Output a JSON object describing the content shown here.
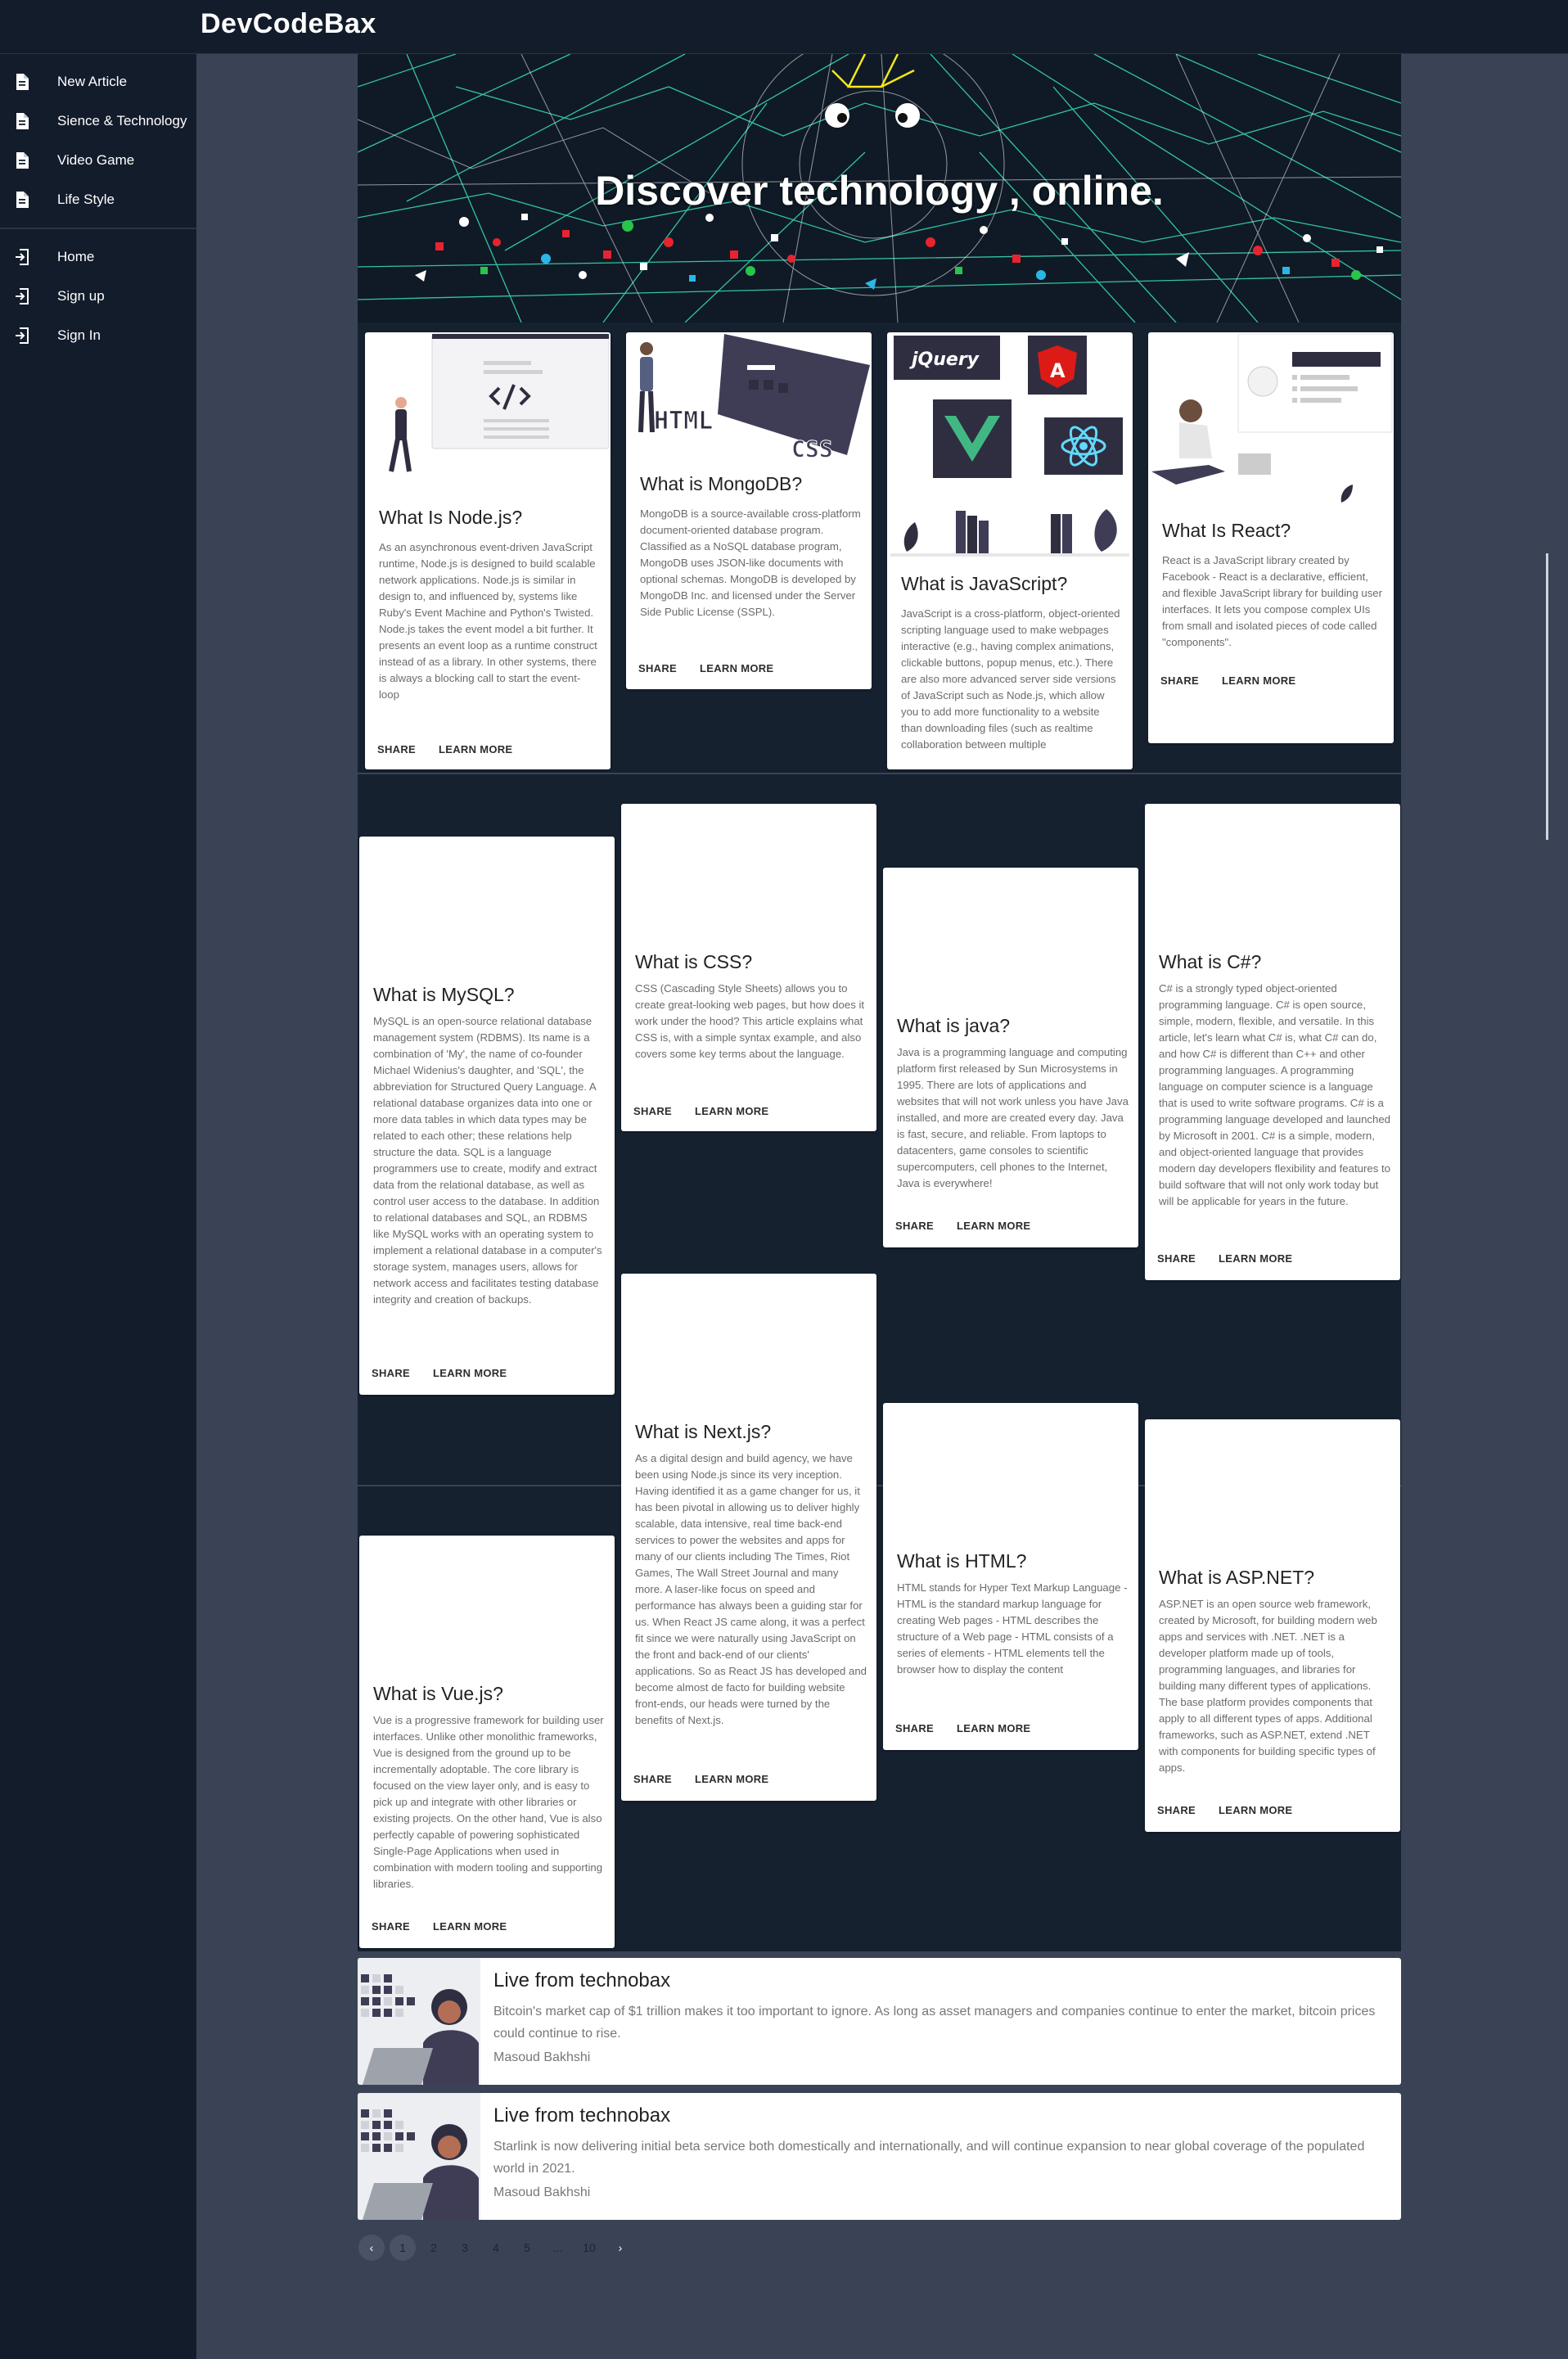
{
  "app": {
    "title": "DevCodeBax"
  },
  "sidebar": {
    "items": [
      {
        "label": "New Article",
        "icon": "article-icon"
      },
      {
        "label": "Sience & Technology",
        "icon": "article-icon"
      },
      {
        "label": "Video Game",
        "icon": "article-icon"
      },
      {
        "label": "Life Style",
        "icon": "article-icon"
      }
    ],
    "account_items": [
      {
        "label": "Home",
        "icon": "login-icon"
      },
      {
        "label": "Sign up",
        "icon": "login-icon"
      },
      {
        "label": "Sign In",
        "icon": "login-icon"
      }
    ]
  },
  "hero": {
    "title": "Discover technology , online."
  },
  "actions": {
    "share": "SHARE",
    "learn_more": "LEARN MORE"
  },
  "cards": [
    {
      "title": "What Is Node.js?",
      "image": "nodejs-illustration",
      "text": "As an asynchronous event-driven JavaScript runtime, Node.js is designed to build scalable network applications. Node.js is similar in design to, and influenced by, systems like Ruby's Event Machine and Python's Twisted. Node.js takes the event model a bit further. It presents an event loop as a runtime construct instead of as a library. In other systems, there is always a blocking call to start the event-loop"
    },
    {
      "title": "What is MongoDB?",
      "image": "html-css-illustration",
      "text": "MongoDB is a source-available cross-platform document-oriented database program. Classified as a NoSQL database program, MongoDB uses JSON-like documents with optional schemas. MongoDB is developed by MongoDB Inc. and licensed under the Server Side Public License (SSPL)."
    },
    {
      "title": "What is JavaScript?",
      "image": "js-frameworks-illustration",
      "text": "JavaScript is a cross-platform, object-oriented scripting language used to make webpages interactive (e.g., having complex animations, clickable buttons, popup menus, etc.). There are also more advanced server side versions of JavaScript such as Node.js, which allow you to add more functionality to a website than downloading files (such as realtime collaboration between multiple"
    },
    {
      "title": "What Is React?",
      "image": "react-illustration",
      "text": "React is a JavaScript library created by Facebook - React is a declarative, efficient, and flexible JavaScript library for building user interfaces. It lets you compose complex UIs from small and isolated pieces of code called \"components\"."
    },
    {
      "title": "What is MySQL?",
      "text": "MySQL is an open-source relational database management system (RDBMS). Its name is a combination of 'My', the name of co-founder Michael Widenius's daughter, and 'SQL', the abbreviation for Structured Query Language. A relational database organizes data into one or more data tables in which data types may be related to each other; these relations help structure the data. SQL is a language programmers use to create, modify and extract data from the relational database, as well as control user access to the database. In addition to relational databases and SQL, an RDBMS like MySQL works with an operating system to implement a relational database in a computer's storage system, manages users, allows for network access and facilitates testing database integrity and creation of backups."
    },
    {
      "title": "What is CSS?",
      "text": "CSS (Cascading Style Sheets) allows you to create great-looking web pages, but how does it work under the hood? This article explains what CSS is, with a simple syntax example, and also covers some key terms about the language."
    },
    {
      "title": "What is java?",
      "text": "Java is a programming language and computing platform first released by Sun Microsystems in 1995. There are lots of applications and websites that will not work unless you have Java installed, and more are created every day. Java is fast, secure, and reliable. From laptops to datacenters, game consoles to scientific supercomputers, cell phones to the Internet, Java is everywhere!"
    },
    {
      "title": "What is C#?",
      "text": "C# is a strongly typed object-oriented programming language. C# is open source, simple, modern, flexible, and versatile. In this article, let's learn what C# is, what C# can do, and how C# is different than C++ and other programming languages. A programming language on computer science is a language that is used to write software programs. C# is a programming language developed and launched by Microsoft in 2001. C# is a simple, modern, and object-oriented language that provides modern day developers flexibility and features to build software that will not only work today but will be applicable for years in the future."
    },
    {
      "title": "What is Next.js?",
      "text": "As a digital design and build agency, we have been using Node.js since its very inception. Having identified it as a game changer for us, it has been pivotal in allowing us to deliver highly scalable, data intensive, real time back-end services to power the websites and apps for many of our clients including The Times, Riot Games, The Wall Street Journal and many more. A laser-like focus on speed and performance has always been a guiding star for us. When React JS came along, it was a perfect fit since we were naturally using JavaScript on the front and back-end of our clients' applications. So as React JS has developed and become almost de facto for building website front-ends, our heads were turned by the benefits of Next.js."
    },
    {
      "title": "What is HTML?",
      "text": "HTML stands for Hyper Text Markup Language - HTML is the standard markup language for creating Web pages - HTML describes the structure of a Web page - HTML consists of a series of elements - HTML elements tell the browser how to display the content"
    },
    {
      "title": "What is Vue.js?",
      "text": "Vue is a progressive framework for building user interfaces. Unlike other monolithic frameworks, Vue is designed from the ground up to be incrementally adoptable. The core library is focused on the view layer only, and is easy to pick up and integrate with other libraries or existing projects. On the other hand, Vue is also perfectly capable of powering sophisticated Single-Page Applications when used in combination with modern tooling and supporting libraries."
    },
    {
      "title": "What is ASP.NET?",
      "text": "ASP.NET is an open source web framework, created by Microsoft, for building modern web apps and services with .NET. .NET is a developer platform made up of tools, programming languages, and libraries for building many different types of applications. The base platform provides components that apply to all different types of apps. Additional frameworks, such as ASP.NET, extend .NET with components for building specific types of apps."
    }
  ],
  "live": [
    {
      "title": "Live from technobax",
      "text": "Bitcoin's market cap of $1 trillion makes it too important to ignore. As long as asset managers and companies continue to enter the market, bitcoin prices could continue to rise.",
      "author": "Masoud Bakhshi"
    },
    {
      "title": "Live from technobax",
      "text": "Starlink is now delivering initial beta service both domestically and internationally, and will continue expansion to near global coverage of the populated world in 2021.",
      "author": "Masoud Bakhshi"
    }
  ],
  "pagination": {
    "prev": "‹",
    "pages": [
      "1",
      "2",
      "3",
      "4",
      "5"
    ],
    "ellipsis": "...",
    "last": "10",
    "next": "›",
    "current": "1"
  },
  "colors": {
    "app_bar": "#131c2b",
    "background": "#3a4255",
    "band": "#162130",
    "hero_lines": "#38d6b0",
    "accent_yellow": "#f6e61e"
  }
}
